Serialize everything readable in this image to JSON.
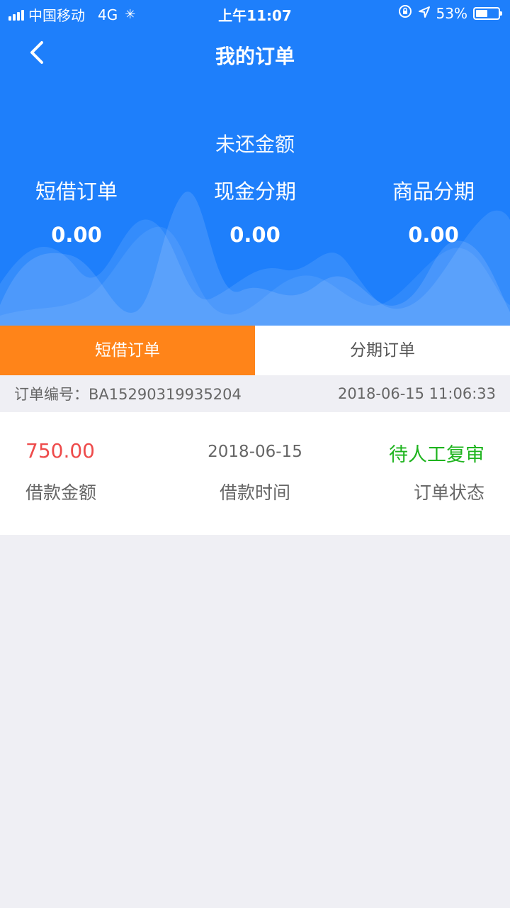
{
  "status_bar": {
    "carrier": "中国移动",
    "network": "4G",
    "time": "上午11:07",
    "battery_percent": "53%",
    "battery_level": 0.53
  },
  "nav": {
    "back_icon": "chevron-left-icon",
    "title": "我的订单"
  },
  "summary": {
    "label": "未还金额",
    "items": [
      {
        "name": "短借订单",
        "amount": "0.00"
      },
      {
        "name": "现金分期",
        "amount": "0.00"
      },
      {
        "name": "商品分期",
        "amount": "0.00"
      }
    ]
  },
  "tabs": [
    {
      "label": "短借订单",
      "active": true
    },
    {
      "label": "分期订单",
      "active": false
    }
  ],
  "order": {
    "number_label": "订单编号：",
    "number": "BA15290319935204",
    "created_at": "2018-06-15 11:06:33",
    "amount": "750.00",
    "amount_label": "借款金额",
    "date": "2018-06-15",
    "date_label": "借款时间",
    "status": "待人工复审",
    "status_label": "订单状态"
  },
  "colors": {
    "header_blue": "#1e7ffb",
    "tab_active": "#ff8419",
    "amount_red": "#ee4b4b",
    "status_green": "#1fb41f",
    "background": "#efeff4"
  }
}
